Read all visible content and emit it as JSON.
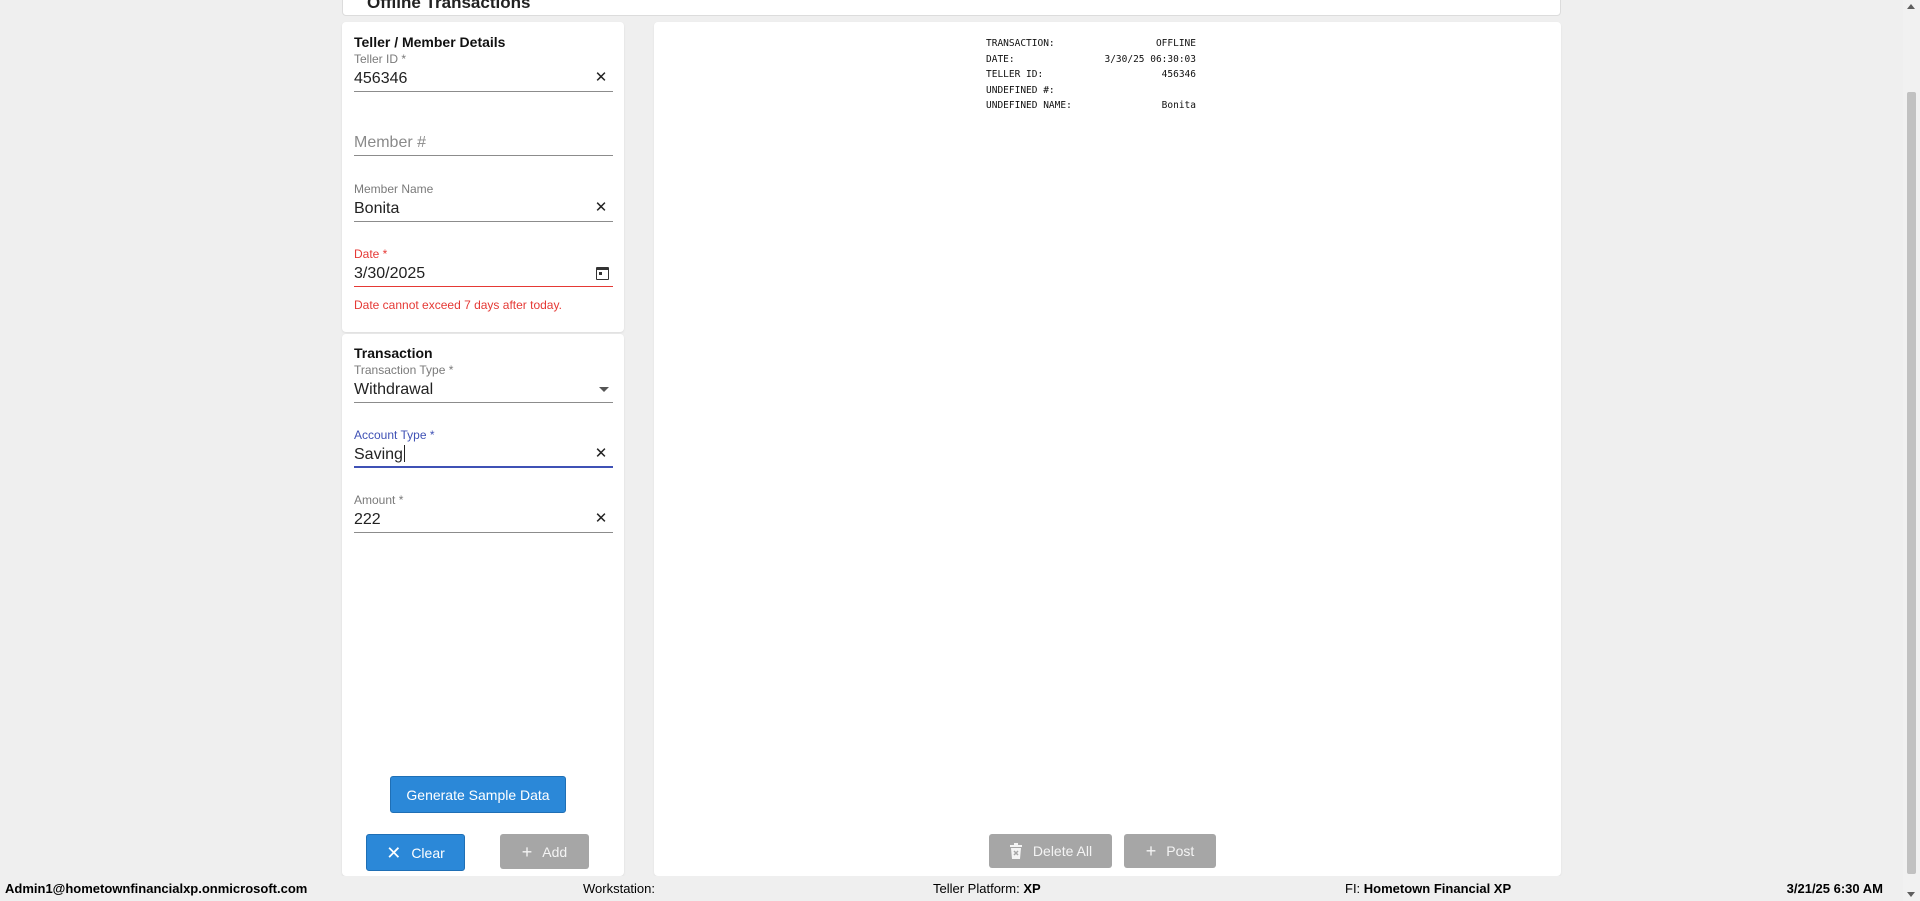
{
  "header": {
    "title": "Offline Transactions"
  },
  "details": {
    "title": "Teller / Member Details",
    "teller_id": {
      "label": "Teller ID *",
      "value": "456346"
    },
    "member_number": {
      "placeholder": "Member #"
    },
    "member_name": {
      "label": "Member Name",
      "value": "Bonita"
    },
    "date": {
      "label": "Date *",
      "value": "3/30/2025",
      "error": "Date cannot exceed 7 days after today."
    }
  },
  "transaction": {
    "title": "Transaction",
    "transaction_type": {
      "label": "Transaction Type *",
      "value": "Withdrawal"
    },
    "account_type": {
      "label": "Account Type *",
      "value": "Saving"
    },
    "amount": {
      "label": "Amount *",
      "value": "222"
    }
  },
  "buttons": {
    "generate": "Generate Sample Data",
    "clear": "Clear",
    "add": "Add",
    "delete_all": "Delete All",
    "post": "Post"
  },
  "receipt": {
    "rows": [
      {
        "key": "TRANSACTION:",
        "value": "OFFLINE"
      },
      {
        "key": "DATE:",
        "value": "3/30/25 06:30:03"
      },
      {
        "key": "TELLER ID:",
        "value": "456346"
      },
      {
        "key": "UNDEFINED #:",
        "value": ""
      },
      {
        "key": "UNDEFINED NAME:",
        "value": "Bonita"
      }
    ]
  },
  "status_bar": {
    "user": "Admin1@hometownfinancialxp.onmicrosoft.com",
    "workstation_label": "Workstation:",
    "workstation_value": "",
    "platform_label": "Teller Platform:",
    "platform_value": "XP",
    "fi_label": "FI:",
    "fi_value": "Hometown Financial XP",
    "datetime": "3/21/25 6:30 AM"
  },
  "colors": {
    "primary": "#2b88d8",
    "error": "#e53935",
    "focus": "#3f51b5",
    "disabled": "#a6a6a6"
  },
  "icons": {
    "clear_field": "close-icon",
    "date": "calendar-icon",
    "dropdown": "chevron-down-icon",
    "clear_button": "close-icon",
    "add_button": "plus-icon",
    "delete_all_button": "trash-icon",
    "post_button": "plus-icon"
  }
}
